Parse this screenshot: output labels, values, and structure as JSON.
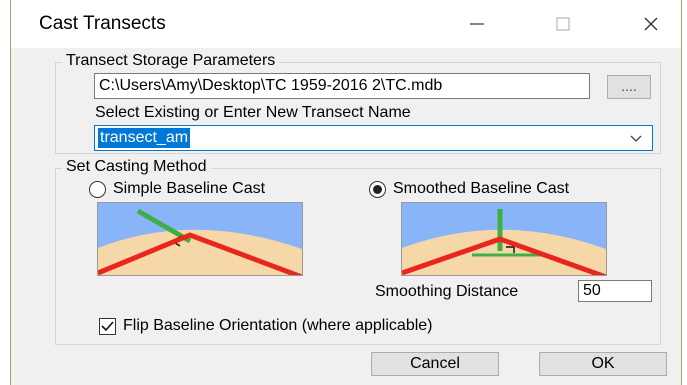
{
  "window": {
    "title": "Cast Transects"
  },
  "storage": {
    "group_label": "Transect Storage Parameters",
    "path_value": "C:\\Users\\Amy\\Desktop\\TC 1959-2016 2\\TC.mdb",
    "browse_label": "....",
    "name_label": "Select Existing or Enter New Transect Name",
    "name_value": "transect_am"
  },
  "casting": {
    "group_label": "Set Casting Method",
    "simple_label": "Simple Baseline Cast",
    "smoothed_label": "Smoothed Baseline Cast",
    "selected": "smoothed",
    "smoothing_label": "Smoothing Distance",
    "smoothing_value": "50",
    "flip_label": "Flip Baseline Orientation (where applicable)",
    "flip_checked": true
  },
  "buttons": {
    "cancel": "Cancel",
    "ok": "OK"
  },
  "colors": {
    "sky": "#8ab4f8",
    "sand": "#f6d7a7",
    "baseline": "#e8261c",
    "transect": "#3cb043",
    "selection": "#0078d7"
  }
}
